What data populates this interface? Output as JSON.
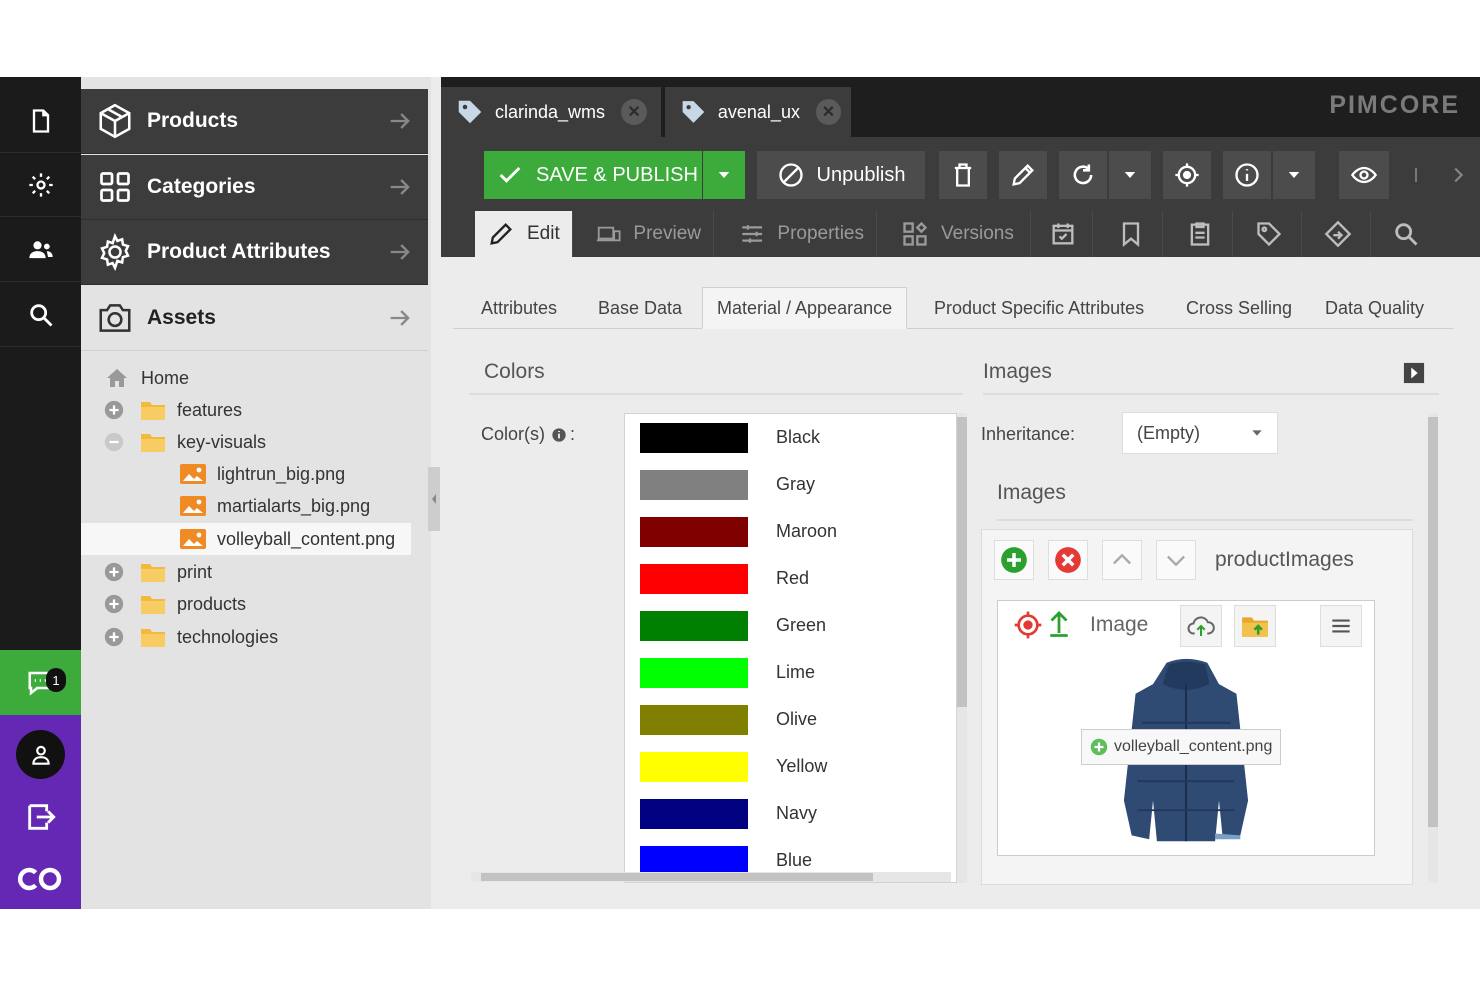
{
  "nav": {
    "items": [
      {
        "label": "Products",
        "icon": "cube-icon"
      },
      {
        "label": "Categories",
        "icon": "grid-icon"
      },
      {
        "label": "Product Attributes",
        "icon": "gear-icon"
      },
      {
        "label": "Assets",
        "icon": "camera-icon"
      }
    ]
  },
  "tree": {
    "rows": [
      {
        "label": "Home",
        "type": "home"
      },
      {
        "label": "features",
        "type": "folder",
        "toggle": "plus"
      },
      {
        "label": "key-visuals",
        "type": "folder",
        "toggle": "minus"
      },
      {
        "label": "lightrun_big.png",
        "type": "image"
      },
      {
        "label": "martialarts_big.png",
        "type": "image"
      },
      {
        "label": "volleyball_content.png",
        "type": "image",
        "selected": true
      },
      {
        "label": "print",
        "type": "folder",
        "toggle": "plus"
      },
      {
        "label": "products",
        "type": "folder",
        "toggle": "plus"
      },
      {
        "label": "technologies",
        "type": "folder",
        "toggle": "plus"
      }
    ]
  },
  "rail": {
    "notification_count": "1"
  },
  "doc_tabs": [
    {
      "label": "clarinda_wms"
    },
    {
      "label": "avenal_ux"
    }
  ],
  "logo": "PIMCORE",
  "toolbar": {
    "save_label": "SAVE & PUBLISH",
    "unpublish_label": "Unpublish"
  },
  "view_tabs": [
    {
      "label": "Edit",
      "active": true
    },
    {
      "label": "Preview"
    },
    {
      "label": "Properties"
    },
    {
      "label": "Versions"
    }
  ],
  "sub_tabs": [
    {
      "label": "Attributes"
    },
    {
      "label": "Base Data"
    },
    {
      "label": "Material / Appearance",
      "active": true
    },
    {
      "label": "Product Specific Attributes"
    },
    {
      "label": "Cross Selling"
    },
    {
      "label": "Data Quality"
    }
  ],
  "colors_panel": {
    "title": "Colors",
    "field_label": "Color(s)",
    "field_suffix": ":",
    "options": [
      {
        "label": "Black",
        "color": "#000000"
      },
      {
        "label": "Gray",
        "color": "#808080"
      },
      {
        "label": "Maroon",
        "color": "#800000"
      },
      {
        "label": "Red",
        "color": "#ff0000"
      },
      {
        "label": "Green",
        "color": "#008000"
      },
      {
        "label": "Lime",
        "color": "#00ff00"
      },
      {
        "label": "Olive",
        "color": "#808000"
      },
      {
        "label": "Yellow",
        "color": "#ffff00"
      },
      {
        "label": "Navy",
        "color": "#000080"
      },
      {
        "label": "Blue",
        "color": "#0000ff"
      }
    ]
  },
  "images_panel": {
    "title": "Images",
    "inheritance_label": "Inheritance:",
    "inheritance_value": "(Empty)",
    "section_title": "Images",
    "gallery_name": "productImages",
    "image_label": "Image",
    "file_name": "volleyball_content.png"
  },
  "colors": {
    "green": "#3cab3c",
    "purple": "#6428b4",
    "dark": "#1b1b1b",
    "toolbar": "#3c3c3c"
  }
}
